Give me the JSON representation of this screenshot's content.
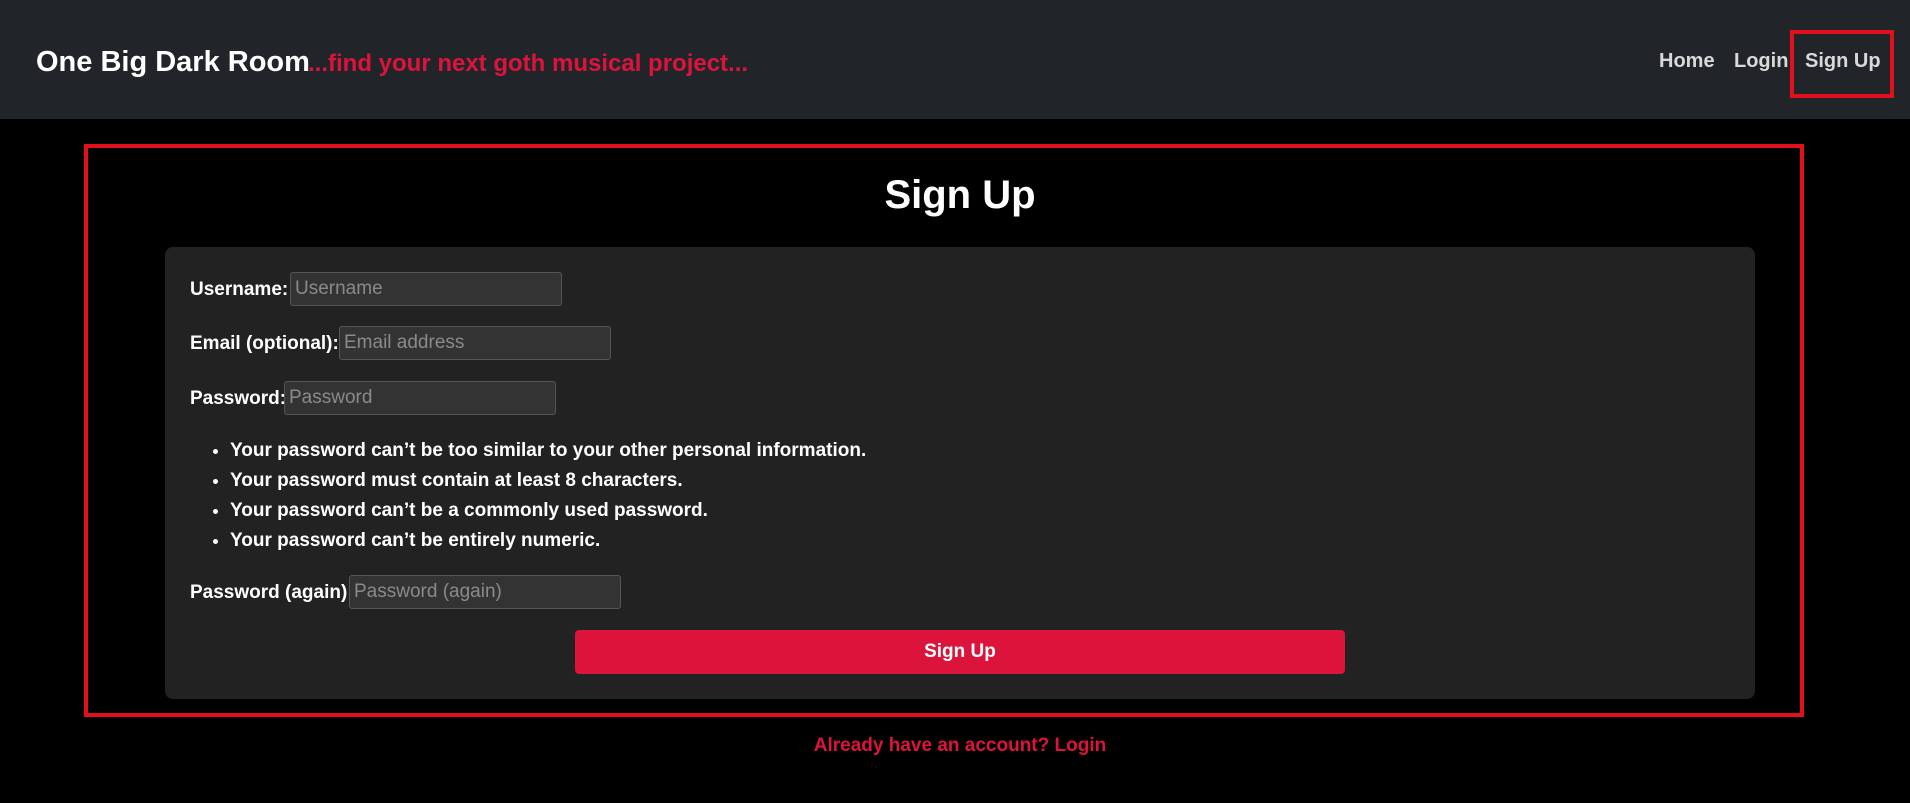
{
  "header": {
    "brand": "One Big Dark Room",
    "tagline": "...find your next goth musical project...",
    "nav": [
      {
        "label": "Home"
      },
      {
        "label": "Login"
      },
      {
        "label": "Sign Up",
        "active": true
      }
    ]
  },
  "page": {
    "title": "Sign Up"
  },
  "form": {
    "username": {
      "label": "Username:",
      "value": "",
      "placeholder": "Username"
    },
    "email": {
      "label": "Email (optional):",
      "value": "",
      "placeholder": "Email address"
    },
    "password": {
      "label": "Password:",
      "value": "",
      "placeholder": "Password"
    },
    "password_help": [
      "Your password can’t be too similar to your other personal information.",
      "Your password must contain at least 8 characters.",
      "Your password can’t be a commonly used password.",
      "Your password can’t be entirely numeric."
    ],
    "password_again": {
      "label": "Password (again):",
      "value": "",
      "placeholder": "Password (again)"
    },
    "submit_label": "Sign Up"
  },
  "footer": {
    "login_prompt": "Already have an account? Login"
  },
  "colors": {
    "accent": "#dc143c",
    "navbar_bg": "#212529",
    "page_bg": "#000000",
    "card_bg": "#222222",
    "annotation_outline": "#e0101c"
  }
}
